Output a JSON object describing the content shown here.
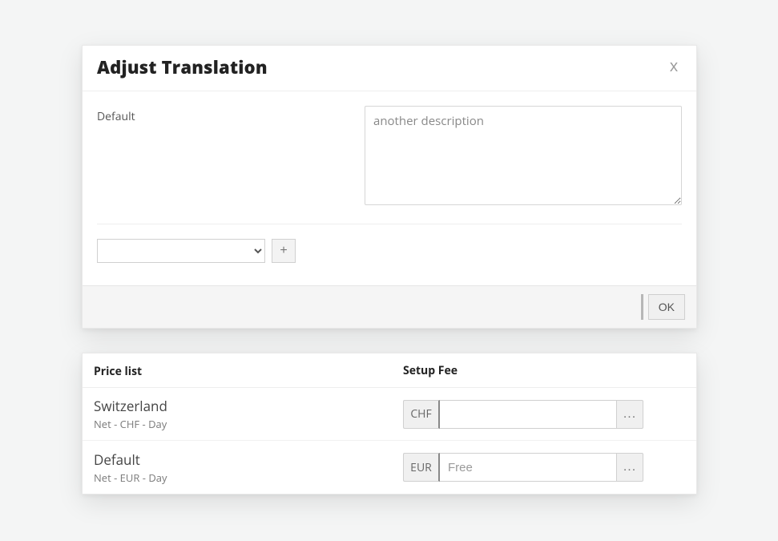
{
  "dialog": {
    "title": "Adjust Translation",
    "close_label": "x",
    "default_label": "Default",
    "description_value": "another description",
    "lang_select_value": "",
    "add_label": "+",
    "ok_label": "OK"
  },
  "price_table": {
    "headers": {
      "price_list": "Price list",
      "setup_fee": "Setup Fee"
    },
    "rows": [
      {
        "name": "Switzerland",
        "sub": "Net - CHF - Day",
        "currency": "CHF",
        "fee_value": "",
        "fee_placeholder": "",
        "more_label": "..."
      },
      {
        "name": "Default",
        "sub": "Net - EUR - Day",
        "currency": "EUR",
        "fee_value": "",
        "fee_placeholder": "Free",
        "more_label": "..."
      }
    ]
  }
}
